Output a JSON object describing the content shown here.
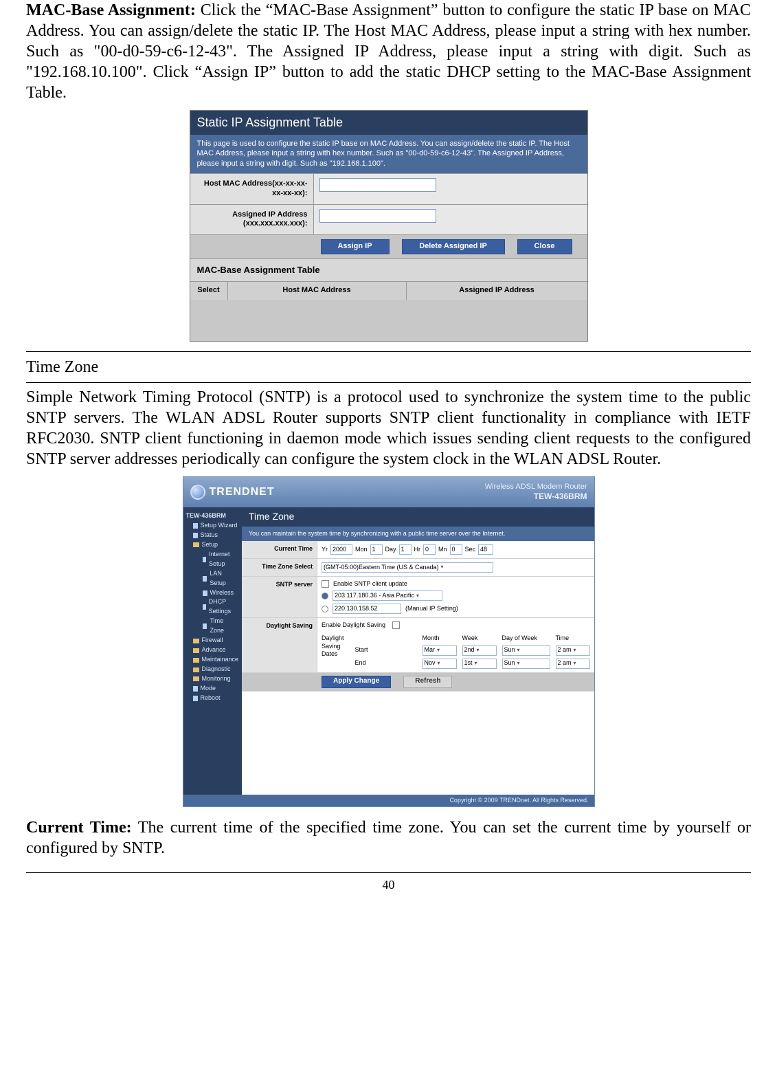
{
  "mac_base_para": {
    "label": "MAC-Base Assignment:",
    "text": " Click the “MAC-Base Assignment” button to configure the static IP base on MAC Address. You can assign/delete the static IP. The Host MAC Address, please input a string with hex number. Such as \"00-d0-59-c6-12-43\". The Assigned IP Address, please input a string with digit. Such as \"192.168.10.100\". Click “Assign IP” button to add the static DHCP setting to the MAC-Base Assignment Table."
  },
  "sip": {
    "title": "Static IP Assignment Table",
    "desc": "This page is used to configure the static IP base on MAC Address. You can assign/delete the static IP. The Host MAC Address, please input a string with hex number. Such as \"00-d0-59-c6-12-43\". The Assigned IP Address, please input a string with digit. Such as \"192.168.1.100\".",
    "row1_label": "Host MAC Address(xx-xx-xx-xx-xx-xx):",
    "row2_label": "Assigned IP Address (xxx.xxx.xxx.xxx):",
    "btn_assign": "Assign IP",
    "btn_delete": "Delete Assigned IP",
    "btn_close": "Close",
    "subtable_title": "MAC-Base Assignment Table",
    "hdr_select": "Select",
    "hdr_mac": "Host MAC Address",
    "hdr_ip": "Assigned IP Address"
  },
  "timezone_heading": "Time Zone",
  "timezone_para": "Simple Network Timing Protocol (SNTP) is a protocol used to synchronize the system time to the public SNTP servers. The WLAN ADSL Router supports SNTP client functionality in compliance with IETF RFC2030. SNTP client functioning in daemon mode which issues sending client requests to the configured SNTP server addresses periodically can configure the system clock in the WLAN ADSL Router.",
  "tz": {
    "brand": "TRENDNET",
    "model_line1": "Wireless ADSL Modem Router",
    "model_line2": "TEW-436BRM",
    "sidebar": {
      "root": "TEW-436BRM",
      "items": [
        {
          "lvl": 1,
          "icon": "file",
          "label": "Setup Wizard"
        },
        {
          "lvl": 1,
          "icon": "file",
          "label": "Status"
        },
        {
          "lvl": 1,
          "icon": "folder",
          "label": "Setup"
        },
        {
          "lvl": 2,
          "icon": "file",
          "label": "Internet Setup"
        },
        {
          "lvl": 2,
          "icon": "file",
          "label": "LAN Setup"
        },
        {
          "lvl": 2,
          "icon": "file",
          "label": "Wireless"
        },
        {
          "lvl": 2,
          "icon": "file",
          "label": "DHCP Settings"
        },
        {
          "lvl": 2,
          "icon": "file",
          "label": "Time Zone"
        },
        {
          "lvl": 1,
          "icon": "folder",
          "label": "Firewall"
        },
        {
          "lvl": 1,
          "icon": "folder",
          "label": "Advance"
        },
        {
          "lvl": 1,
          "icon": "folder",
          "label": "Maintainance"
        },
        {
          "lvl": 1,
          "icon": "folder",
          "label": "Diagnostic"
        },
        {
          "lvl": 1,
          "icon": "folder",
          "label": "Monitoring"
        },
        {
          "lvl": 1,
          "icon": "file",
          "label": "Mode"
        },
        {
          "lvl": 1,
          "icon": "file",
          "label": "Reboot"
        }
      ]
    },
    "main": {
      "title": "Time Zone",
      "desc": "You can maintain the system time by synchronizing with a public time server over the Internet.",
      "current_time": {
        "label": "Current Time",
        "yr_lbl": "Yr",
        "yr": "2000",
        "mon_lbl": "Mon",
        "mon": "1",
        "day_lbl": "Day",
        "day": "1",
        "hr_lbl": "Hr",
        "hr": "0",
        "mn_lbl": "Mn",
        "mn": "0",
        "sec_lbl": "Sec",
        "sec": "48"
      },
      "tzselect": {
        "label": "Time Zone Select",
        "value": "(GMT-05:00)Eastern Time (US & Canada)"
      },
      "sntp": {
        "label": "SNTP server",
        "enable_label": "Enable SNTP client update",
        "opt1": "203.117.180.36 - Asia Pacific",
        "opt2": "220.130.158.52",
        "manual": "(Manual IP Setting)"
      },
      "daylight": {
        "label": "Daylight Saving",
        "enable_label": "Enable Daylight Saving",
        "dates_label": "Daylight Saving Dates",
        "col_month": "Month",
        "col_week": "Week",
        "col_dow": "Day of Week",
        "col_time": "Time",
        "row_start": "Start",
        "start_month": "Mar",
        "start_week": "2nd",
        "start_dow": "Sun",
        "start_time": "2 am",
        "row_end": "End",
        "end_month": "Nov",
        "end_week": "1st",
        "end_dow": "Sun",
        "end_time": "2 am"
      },
      "btn_apply": "Apply Change",
      "btn_refresh": "Refresh"
    },
    "footer": "Copyright © 2009 TRENDnet. All Rights Reserved."
  },
  "current_time_para": {
    "label": "Current Time:",
    "text": "  The current time of the specified time zone. You can set the current time by yourself or configured by SNTP."
  },
  "page_number": "40"
}
